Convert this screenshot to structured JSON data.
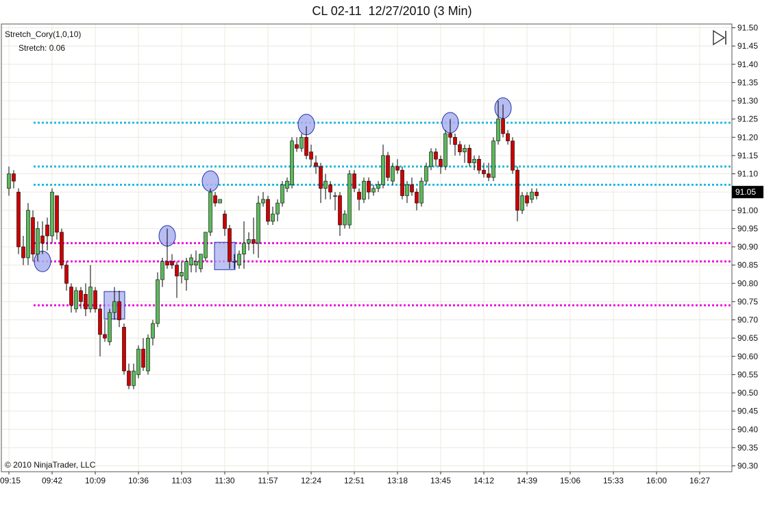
{
  "chart_title": "CL 02-11  12/27/2010 (3 Min)",
  "indicator": {
    "name": "Stretch_Cory(1,0,10)",
    "stretch_label": "Stretch:",
    "stretch_value": "0.06"
  },
  "copyright": "© 2010 NinjaTrader, LLC",
  "current_price_label": "91.05",
  "icons": {
    "navigate": "skip-to-end-icon"
  },
  "colors": {
    "up": "#5cb85c",
    "down": "#cc0000",
    "resistance": "#22bbdd",
    "support": "#ee11dd",
    "marker_fill": "#aab0ee",
    "marker_stroke": "#2233aa",
    "grid": "#ece8dc"
  },
  "chart_data": {
    "type": "candlestick",
    "title": "CL 02-11  12/27/2010 (3 Min)",
    "ylim": [
      90.3,
      91.5
    ],
    "yticks": [
      "91.50",
      "91.45",
      "91.40",
      "91.35",
      "91.30",
      "91.25",
      "91.20",
      "91.15",
      "91.10",
      "91.05",
      "91.00",
      "90.95",
      "90.90",
      "90.85",
      "90.80",
      "90.75",
      "90.70",
      "90.65",
      "90.60",
      "90.55",
      "90.50",
      "90.45",
      "90.40",
      "90.35",
      "90.30"
    ],
    "xticks": [
      "09:15",
      "09:42",
      "10:09",
      "10:36",
      "11:03",
      "11:30",
      "11:57",
      "12:24",
      "12:51",
      "13:18",
      "13:45",
      "14:12",
      "14:39",
      "15:06",
      "15:33",
      "16:00",
      "16:27"
    ],
    "xrange_min": [
      0,
      442
    ],
    "xtick_minutes": [
      0,
      27,
      54,
      81,
      108,
      135,
      162,
      189,
      216,
      243,
      270,
      297,
      324,
      351,
      378,
      405,
      432
    ],
    "last_price": 91.05,
    "horizontal_lines": [
      {
        "price": 91.24,
        "style": "resistance"
      },
      {
        "price": 91.12,
        "style": "resistance"
      },
      {
        "price": 91.07,
        "style": "resistance"
      },
      {
        "price": 90.91,
        "style": "support"
      },
      {
        "price": 90.86,
        "style": "support"
      },
      {
        "price": 90.74,
        "style": "support"
      }
    ],
    "markers": [
      {
        "shape": "circle",
        "minute": 21,
        "price": 90.86
      },
      {
        "shape": "square",
        "minute": 66,
        "price": 90.74
      },
      {
        "shape": "circle",
        "minute": 99,
        "price": 90.93
      },
      {
        "shape": "circle",
        "minute": 126,
        "price": 91.08
      },
      {
        "shape": "square",
        "minute": 135,
        "price": 90.875
      },
      {
        "shape": "circle",
        "minute": 186,
        "price": 91.235
      },
      {
        "shape": "circle",
        "minute": 276,
        "price": 91.24
      },
      {
        "shape": "circle",
        "minute": 309,
        "price": 91.28
      }
    ],
    "candles": [
      [
        0,
        91.06,
        91.12,
        91.04,
        91.1
      ],
      [
        3,
        91.1,
        91.11,
        91.06,
        91.08
      ],
      [
        6,
        91.05,
        91.06,
        90.88,
        90.9
      ],
      [
        9,
        90.9,
        90.93,
        90.85,
        90.87
      ],
      [
        12,
        90.87,
        91.02,
        90.85,
        91.0
      ],
      [
        15,
        90.98,
        91.0,
        90.86,
        90.88
      ],
      [
        18,
        90.88,
        90.97,
        90.86,
        90.95
      ],
      [
        21,
        90.93,
        90.97,
        90.88,
        90.91
      ],
      [
        24,
        90.96,
        90.98,
        90.89,
        90.93
      ],
      [
        27,
        90.93,
        91.06,
        90.91,
        91.05
      ],
      [
        30,
        91.04,
        91.04,
        90.92,
        90.94
      ],
      [
        33,
        90.94,
        90.95,
        90.84,
        90.85
      ],
      [
        36,
        90.85,
        90.86,
        90.78,
        90.8
      ],
      [
        39,
        90.79,
        90.8,
        90.72,
        90.74
      ],
      [
        42,
        90.73,
        90.79,
        90.72,
        90.78
      ],
      [
        45,
        90.78,
        90.79,
        90.73,
        90.75
      ],
      [
        48,
        90.77,
        90.8,
        90.71,
        90.73
      ],
      [
        51,
        90.73,
        90.85,
        90.72,
        90.79
      ],
      [
        54,
        90.78,
        90.79,
        90.72,
        90.73
      ],
      [
        57,
        90.73,
        90.74,
        90.6,
        90.66
      ],
      [
        60,
        90.66,
        90.7,
        90.64,
        90.65
      ],
      [
        63,
        90.64,
        90.73,
        90.63,
        90.72
      ],
      [
        66,
        90.72,
        90.79,
        90.7,
        90.75
      ],
      [
        69,
        90.75,
        90.78,
        90.68,
        90.7
      ],
      [
        72,
        90.68,
        90.69,
        90.55,
        90.56
      ],
      [
        75,
        90.56,
        90.58,
        90.51,
        90.52
      ],
      [
        78,
        90.52,
        90.58,
        90.51,
        90.56
      ],
      [
        81,
        90.55,
        90.63,
        90.54,
        90.62
      ],
      [
        84,
        90.62,
        90.65,
        90.56,
        90.57
      ],
      [
        87,
        90.56,
        90.66,
        90.55,
        90.65
      ],
      [
        90,
        90.65,
        90.7,
        90.63,
        90.69
      ],
      [
        93,
        90.69,
        90.83,
        90.68,
        90.81
      ],
      [
        96,
        90.81,
        90.87,
        90.79,
        90.86
      ],
      [
        99,
        90.86,
        90.95,
        90.84,
        90.85
      ],
      [
        102,
        90.86,
        90.88,
        90.84,
        90.85
      ],
      [
        105,
        90.85,
        90.86,
        90.76,
        90.82
      ],
      [
        108,
        90.82,
        90.86,
        90.8,
        90.83
      ],
      [
        111,
        90.81,
        90.87,
        90.78,
        90.86
      ],
      [
        114,
        90.85,
        90.88,
        90.83,
        90.87
      ],
      [
        117,
        90.85,
        90.89,
        90.83,
        90.86
      ],
      [
        120,
        90.84,
        90.87,
        90.83,
        90.88
      ],
      [
        123,
        90.87,
        90.92,
        90.86,
        90.94
      ],
      [
        126,
        90.94,
        91.06,
        90.93,
        91.05
      ],
      [
        129,
        91.04,
        91.05,
        91.01,
        91.02
      ],
      [
        132,
        91.02,
        91.03,
        91.02,
        91.03
      ],
      [
        135,
        90.99,
        91.0,
        90.93,
        90.95
      ],
      [
        138,
        90.95,
        90.96,
        90.84,
        90.86
      ],
      [
        141,
        90.86,
        90.88,
        90.84,
        90.86
      ],
      [
        144,
        90.85,
        90.89,
        90.84,
        90.88
      ],
      [
        147,
        90.88,
        90.97,
        90.84,
        90.91
      ],
      [
        150,
        90.91,
        90.94,
        90.89,
        90.92
      ],
      [
        153,
        90.92,
        90.98,
        90.88,
        90.91
      ],
      [
        156,
        90.91,
        91.04,
        90.87,
        91.02
      ],
      [
        159,
        91.02,
        91.05,
        91.01,
        91.03
      ],
      [
        162,
        91.03,
        91.04,
        90.96,
        90.97
      ],
      [
        165,
        90.97,
        91.01,
        90.96,
        90.99
      ],
      [
        168,
        90.99,
        91.03,
        90.97,
        91.02
      ],
      [
        171,
        91.02,
        91.08,
        91.01,
        91.07
      ],
      [
        174,
        91.06,
        91.09,
        91.05,
        91.08
      ],
      [
        177,
        91.07,
        91.2,
        91.06,
        91.19
      ],
      [
        180,
        91.18,
        91.2,
        91.16,
        91.17
      ],
      [
        183,
        91.17,
        91.21,
        91.16,
        91.2
      ],
      [
        186,
        91.2,
        91.23,
        91.14,
        91.15
      ],
      [
        189,
        91.16,
        91.18,
        91.12,
        91.14
      ],
      [
        192,
        91.13,
        91.15,
        91.1,
        91.12
      ],
      [
        195,
        91.12,
        91.13,
        91.02,
        91.06
      ],
      [
        198,
        91.06,
        91.1,
        91.03,
        91.08
      ],
      [
        201,
        91.07,
        91.08,
        91.03,
        91.05
      ],
      [
        204,
        91.04,
        91.05,
        91.0,
        91.04
      ],
      [
        207,
        91.04,
        91.05,
        90.93,
        90.96
      ],
      [
        210,
        90.96,
        91.0,
        90.95,
        90.99
      ],
      [
        213,
        90.96,
        91.11,
        90.95,
        91.1
      ],
      [
        216,
        91.1,
        91.11,
        91.05,
        91.06
      ],
      [
        219,
        91.05,
        91.06,
        91.0,
        91.03
      ],
      [
        222,
        91.03,
        91.09,
        91.02,
        91.08
      ],
      [
        225,
        91.08,
        91.09,
        91.03,
        91.05
      ],
      [
        228,
        91.05,
        91.07,
        91.04,
        91.06
      ],
      [
        231,
        91.06,
        91.08,
        91.05,
        91.07
      ],
      [
        234,
        91.07,
        91.18,
        91.06,
        91.15
      ],
      [
        237,
        91.15,
        91.16,
        91.08,
        91.09
      ],
      [
        240,
        91.08,
        91.13,
        91.07,
        91.12
      ],
      [
        243,
        91.12,
        91.14,
        91.1,
        91.11
      ],
      [
        246,
        91.11,
        91.12,
        91.03,
        91.04
      ],
      [
        249,
        91.04,
        91.08,
        91.02,
        91.07
      ],
      [
        252,
        91.07,
        91.09,
        91.04,
        91.05
      ],
      [
        255,
        91.05,
        91.06,
        91.0,
        91.02
      ],
      [
        258,
        91.02,
        91.09,
        91.01,
        91.08
      ],
      [
        261,
        91.08,
        91.13,
        91.07,
        91.12
      ],
      [
        264,
        91.12,
        91.17,
        91.11,
        91.16
      ],
      [
        267,
        91.16,
        91.17,
        91.12,
        91.14
      ],
      [
        270,
        91.14,
        91.15,
        91.1,
        91.12
      ],
      [
        273,
        91.12,
        91.22,
        91.11,
        91.21
      ],
      [
        276,
        91.21,
        91.25,
        91.18,
        91.2
      ],
      [
        279,
        91.2,
        91.21,
        91.15,
        91.18
      ],
      [
        282,
        91.18,
        91.19,
        91.15,
        91.16
      ],
      [
        285,
        91.16,
        91.18,
        91.13,
        91.17
      ],
      [
        288,
        91.17,
        91.18,
        91.12,
        91.13
      ],
      [
        291,
        91.13,
        91.15,
        91.11,
        91.14
      ],
      [
        294,
        91.14,
        91.15,
        91.1,
        91.11
      ],
      [
        297,
        91.11,
        91.13,
        91.09,
        91.1
      ],
      [
        300,
        91.1,
        91.13,
        91.08,
        91.09
      ],
      [
        303,
        91.09,
        91.2,
        91.08,
        91.19
      ],
      [
        306,
        91.19,
        91.3,
        91.18,
        91.25
      ],
      [
        309,
        91.25,
        91.29,
        91.2,
        91.21
      ],
      [
        312,
        91.21,
        91.22,
        91.18,
        91.19
      ],
      [
        315,
        91.19,
        91.2,
        91.1,
        91.11
      ],
      [
        318,
        91.11,
        91.12,
        90.97,
        91.0
      ],
      [
        321,
        91.0,
        91.05,
        90.99,
        91.04
      ],
      [
        324,
        91.04,
        91.05,
        91.01,
        91.02
      ],
      [
        327,
        91.03,
        91.06,
        91.02,
        91.05
      ],
      [
        330,
        91.05,
        91.06,
        91.03,
        91.04
      ]
    ]
  }
}
